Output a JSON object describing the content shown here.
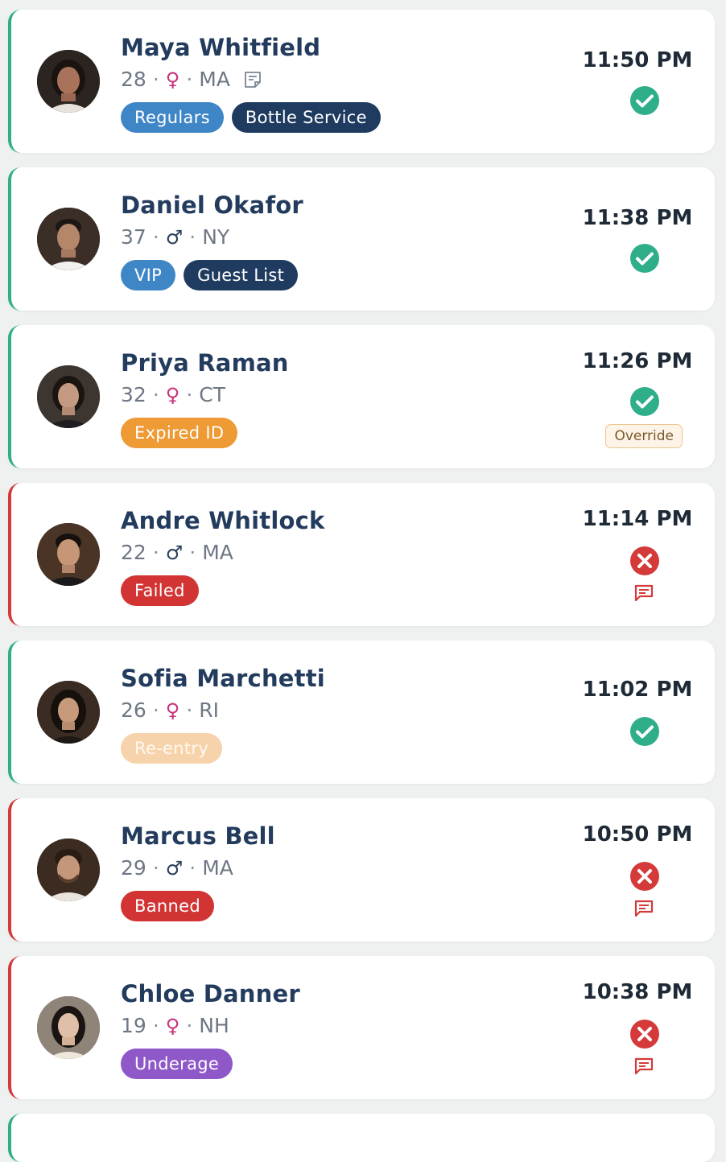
{
  "entries": [
    {
      "name": "Maya Whitfield",
      "age": "28",
      "gender": "♀",
      "state": "MA",
      "time": "11:50 PM",
      "status": "approved",
      "tags": [
        "Regulars",
        "Bottle Service"
      ],
      "has_note": true
    },
    {
      "name": "Daniel Okafor",
      "age": "37",
      "gender": "♂",
      "state": "NY",
      "time": "11:38 PM",
      "status": "approved",
      "tags": [
        "VIP",
        "Guest List"
      ]
    },
    {
      "name": "Priya Raman",
      "age": "32",
      "gender": "♀",
      "state": "CT",
      "time": "11:26 PM",
      "status": "approved",
      "tags": [
        "Expired ID"
      ],
      "override_label": "Override"
    },
    {
      "name": "Andre Whitlock",
      "age": "22",
      "gender": "♂",
      "state": "MA",
      "time": "11:14 PM",
      "status": "denied",
      "tags": [
        "Failed"
      ],
      "has_comment": true
    },
    {
      "name": "Sofia Marchetti",
      "age": "26",
      "gender": "♀",
      "state": "RI",
      "time": "11:02 PM",
      "status": "approved",
      "tags": [
        "Re-entry"
      ]
    },
    {
      "name": "Marcus Bell",
      "age": "29",
      "gender": "♂",
      "state": "MA",
      "time": "10:50 PM",
      "status": "denied",
      "tags": [
        "Banned"
      ],
      "has_comment": true
    },
    {
      "name": "Chloe Danner",
      "age": "19",
      "gender": "♀",
      "state": "NH",
      "time": "10:38 PM",
      "status": "denied",
      "tags": [
        "Underage"
      ],
      "has_comment": true
    }
  ],
  "separator": "·",
  "colors": {
    "approved_accent": "#2fae8a",
    "denied_accent": "#d43a3a",
    "approved_icon": "#2fae8a",
    "denied_icon": "#d43a3a",
    "name_text": "#233c5e",
    "female_symbol": "#c8327a"
  },
  "icons": {
    "approved": "check-circle-icon",
    "denied": "x-circle-icon",
    "note": "note-icon",
    "comment": "comment-icon"
  }
}
